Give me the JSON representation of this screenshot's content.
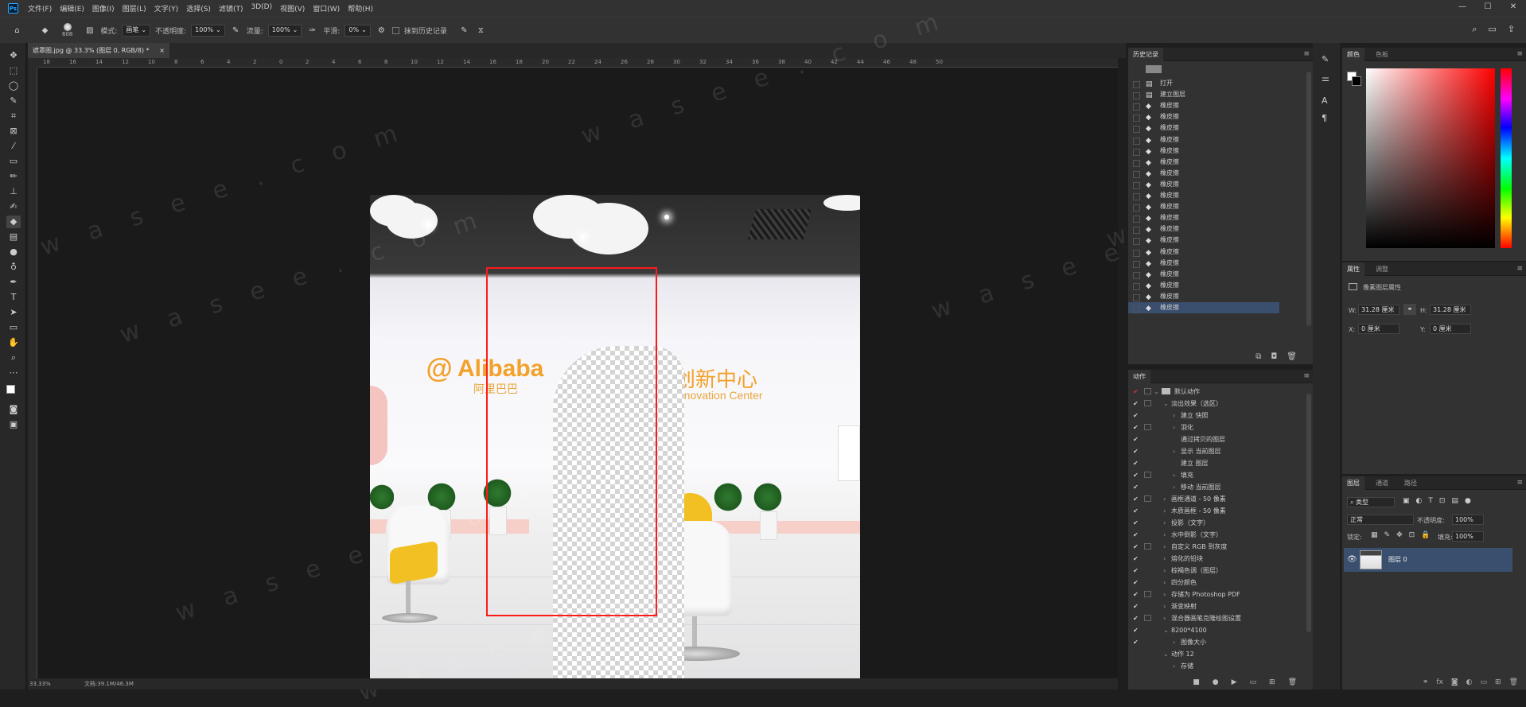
{
  "app": {
    "logo": "Ps",
    "menus": [
      "文件(F)",
      "编辑(E)",
      "图像(I)",
      "图层(L)",
      "文字(Y)",
      "选择(S)",
      "滤镜(T)",
      "3D(D)",
      "视图(V)",
      "窗口(W)",
      "帮助(H)"
    ],
    "window_controls": [
      "—",
      "☐",
      "✕"
    ]
  },
  "options": {
    "brush_size": "608",
    "mode_label": "模式:",
    "mode_value": "画笔",
    "opacity_label": "不透明度:",
    "opacity_value": "100%",
    "flow_label": "流量:",
    "flow_value": "100%",
    "smooth_label": "平滑:",
    "smooth_value": "0%",
    "erase_history": "抹到历史记录"
  },
  "document": {
    "tab_title": "遮罩图.jpg @ 33.3% (图层 0, RGB/8) *",
    "tab_close": "×",
    "zoom": "33.33%",
    "doc_info": "文档:39.1M/46.3M"
  },
  "ruler": {
    "ticks": [
      "18",
      "16",
      "14",
      "12",
      "10",
      "8",
      "6",
      "4",
      "2",
      "0",
      "2",
      "4",
      "6",
      "8",
      "10",
      "12",
      "14",
      "16",
      "18",
      "20",
      "22",
      "24",
      "26",
      "28",
      "30",
      "32",
      "34",
      "36",
      "38",
      "40",
      "42",
      "44",
      "46",
      "48",
      "50"
    ]
  },
  "image_text": {
    "brand_en": "Alibaba",
    "brand_cn": "阿里巴巴",
    "center_cn": "创新中心",
    "center_en": "Innovation Center"
  },
  "watermark": "w a s e e . c o m",
  "history": {
    "title": "历史记录",
    "items": [
      {
        "icon": "open-icon",
        "label": "打开"
      },
      {
        "icon": "new-layer-icon",
        "label": "建立图层"
      },
      {
        "icon": "eraser-icon",
        "label": "橡皮擦"
      },
      {
        "icon": "eraser-icon",
        "label": "橡皮擦"
      },
      {
        "icon": "eraser-icon",
        "label": "橡皮擦"
      },
      {
        "icon": "eraser-icon",
        "label": "橡皮擦"
      },
      {
        "icon": "eraser-icon",
        "label": "橡皮擦"
      },
      {
        "icon": "eraser-icon",
        "label": "橡皮擦"
      },
      {
        "icon": "eraser-icon",
        "label": "橡皮擦"
      },
      {
        "icon": "eraser-icon",
        "label": "橡皮擦"
      },
      {
        "icon": "eraser-icon",
        "label": "橡皮擦"
      },
      {
        "icon": "eraser-icon",
        "label": "橡皮擦"
      },
      {
        "icon": "eraser-icon",
        "label": "橡皮擦"
      },
      {
        "icon": "eraser-icon",
        "label": "橡皮擦"
      },
      {
        "icon": "eraser-icon",
        "label": "橡皮擦"
      },
      {
        "icon": "eraser-icon",
        "label": "橡皮擦"
      },
      {
        "icon": "eraser-icon",
        "label": "橡皮擦"
      },
      {
        "icon": "eraser-icon",
        "label": "橡皮擦"
      },
      {
        "icon": "eraser-icon",
        "label": "橡皮擦"
      },
      {
        "icon": "eraser-icon",
        "label": "橡皮擦"
      },
      {
        "icon": "eraser-icon",
        "label": "橡皮擦"
      }
    ]
  },
  "actions": {
    "title": "动作",
    "items": [
      {
        "check": "✔",
        "box": true,
        "level": 0,
        "arrow": "⌄",
        "label": "默认动作",
        "folder": true
      },
      {
        "check": "✔",
        "box": true,
        "level": 1,
        "arrow": "⌄",
        "label": "淡出效果（选区）"
      },
      {
        "check": "✔",
        "box": false,
        "level": 2,
        "arrow": "›",
        "label": "建立 快照"
      },
      {
        "check": "✔",
        "box": true,
        "level": 2,
        "arrow": "›",
        "label": "羽化"
      },
      {
        "check": "✔",
        "box": false,
        "level": 2,
        "arrow": "",
        "label": "通过拷贝的图层"
      },
      {
        "check": "✔",
        "box": false,
        "level": 2,
        "arrow": "›",
        "label": "显示 当前图层"
      },
      {
        "check": "✔",
        "box": false,
        "level": 2,
        "arrow": "",
        "label": "建立 图层"
      },
      {
        "check": "✔",
        "box": true,
        "level": 2,
        "arrow": "›",
        "label": "填充"
      },
      {
        "check": "✔",
        "box": false,
        "level": 2,
        "arrow": "›",
        "label": "移动 当前图层"
      },
      {
        "check": "✔",
        "box": true,
        "level": 1,
        "arrow": "›",
        "label": "画框通道 - 50 像素"
      },
      {
        "check": "✔",
        "box": false,
        "level": 1,
        "arrow": "›",
        "label": "木质画框 - 50 像素"
      },
      {
        "check": "✔",
        "box": false,
        "level": 1,
        "arrow": "›",
        "label": "投影（文字）"
      },
      {
        "check": "✔",
        "box": false,
        "level": 1,
        "arrow": "›",
        "label": "水中倒影（文字）"
      },
      {
        "check": "✔",
        "box": true,
        "level": 1,
        "arrow": "›",
        "label": "自定义 RGB 到灰度"
      },
      {
        "check": "✔",
        "box": false,
        "level": 1,
        "arrow": "›",
        "label": "熔化的铅块"
      },
      {
        "check": "✔",
        "box": false,
        "level": 1,
        "arrow": "›",
        "label": "棕褐色调（图层）"
      },
      {
        "check": "✔",
        "box": false,
        "level": 1,
        "arrow": "›",
        "label": "四分颜色"
      },
      {
        "check": "✔",
        "box": true,
        "level": 1,
        "arrow": "›",
        "label": "存储为 Photoshop PDF"
      },
      {
        "check": "✔",
        "box": false,
        "level": 1,
        "arrow": "›",
        "label": "渐变映射"
      },
      {
        "check": "✔",
        "box": true,
        "level": 1,
        "arrow": "›",
        "label": "混合器画笔克隆绘图设置"
      },
      {
        "check": "✔",
        "box": false,
        "level": 1,
        "arrow": "⌄",
        "label": "8200*4100"
      },
      {
        "check": "✔",
        "box": false,
        "level": 2,
        "arrow": "›",
        "label": "图像大小"
      },
      {
        "check": "",
        "box": false,
        "level": 1,
        "arrow": "⌄",
        "label": "动作 12"
      },
      {
        "check": "",
        "box": false,
        "level": 2,
        "arrow": "›",
        "label": "存储"
      }
    ]
  },
  "color_panel": {
    "tabs": [
      "颜色",
      "色板"
    ]
  },
  "properties": {
    "tabs": [
      "属性",
      "调整"
    ],
    "heading": "像素图层属性",
    "w_label": "W:",
    "w_value": "31.28 厘米",
    "h_label": "H:",
    "h_value": "31.28 厘米",
    "x_label": "X:",
    "x_value": "0 厘米",
    "y_label": "Y:",
    "y_value": "0 厘米"
  },
  "layers": {
    "tabs": [
      "图层",
      "通道",
      "路径"
    ],
    "filter": "类型",
    "blend": "正常",
    "opacity_label": "不透明度:",
    "opacity_value": "100%",
    "lock_label": "锁定:",
    "fill_label": "填充:",
    "fill_value": "100%",
    "layer_name": "图层 0"
  }
}
